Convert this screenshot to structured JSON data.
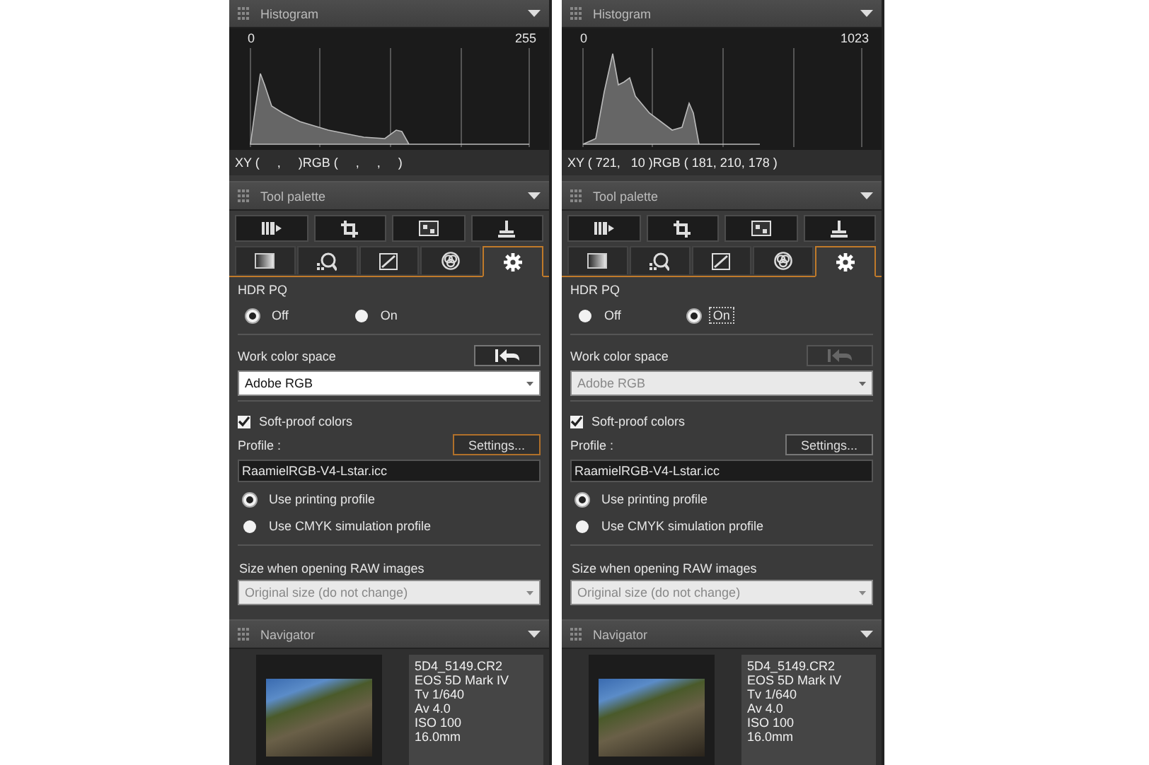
{
  "panels": [
    {
      "histogram": {
        "title": "Histogram",
        "min_label": "0",
        "max_label": "255",
        "readout": "XY (     ,     )RGB (     ,     ,     )"
      },
      "tool_palette": {
        "title": "Tool palette",
        "tabs": [
          {
            "selected": false
          },
          {
            "selected": false
          },
          {
            "selected": false
          },
          {
            "selected": false
          },
          {
            "selected": true
          }
        ]
      },
      "hdr_pq": {
        "label": "HDR PQ",
        "options": [
          {
            "label": "Off",
            "selected": true,
            "focused": false
          },
          {
            "label": "On",
            "selected": false,
            "focused": false
          }
        ]
      },
      "work_color_space": {
        "label": "Work color space",
        "reset_disabled": false,
        "value": "Adobe RGB",
        "disabled": false
      },
      "soft_proof": {
        "label": "Soft-proof colors",
        "checked": true
      },
      "profile": {
        "label": "Profile :",
        "settings_button": "Settings...",
        "settings_focused": true,
        "value": "RaamielRGB-V4-Lstar.icc"
      },
      "profile_options": [
        {
          "label": "Use printing profile",
          "selected": true
        },
        {
          "label": "Use CMYK simulation profile",
          "selected": false
        }
      ],
      "raw_size": {
        "label": "Size when opening RAW images",
        "value": "Original size (do not change)",
        "disabled": true
      },
      "navigator": {
        "title": "Navigator",
        "info": [
          "5D4_5149.CR2",
          "EOS 5D Mark IV",
          "Tv 1/640",
          "Av 4.0",
          "ISO 100",
          "16.0mm"
        ]
      }
    },
    {
      "histogram": {
        "title": "Histogram",
        "min_label": "0",
        "max_label": "1023",
        "readout": "XY ( 721,   10 )RGB ( 181, 210, 178 )"
      },
      "tool_palette": {
        "title": "Tool palette",
        "tabs": [
          {
            "selected": false
          },
          {
            "selected": false
          },
          {
            "selected": false
          },
          {
            "selected": false
          },
          {
            "selected": true
          }
        ]
      },
      "hdr_pq": {
        "label": "HDR PQ",
        "options": [
          {
            "label": "Off",
            "selected": false,
            "focused": false
          },
          {
            "label": "On",
            "selected": true,
            "focused": true
          }
        ]
      },
      "work_color_space": {
        "label": "Work color space",
        "reset_disabled": true,
        "value": "Adobe RGB",
        "disabled": true
      },
      "soft_proof": {
        "label": "Soft-proof colors",
        "checked": true
      },
      "profile": {
        "label": "Profile :",
        "settings_button": "Settings...",
        "settings_focused": false,
        "value": "RaamielRGB-V4-Lstar.icc"
      },
      "profile_options": [
        {
          "label": "Use printing profile",
          "selected": true
        },
        {
          "label": "Use CMYK simulation profile",
          "selected": false
        }
      ],
      "raw_size": {
        "label": "Size when opening RAW images",
        "value": "Original size (do not change)",
        "disabled": true
      },
      "navigator": {
        "title": "Navigator",
        "info": [
          "5D4_5149.CR2",
          "EOS 5D Mark IV",
          "Tv 1/640",
          "Av 4.0",
          "ISO 100",
          "16.0mm"
        ]
      }
    }
  ]
}
